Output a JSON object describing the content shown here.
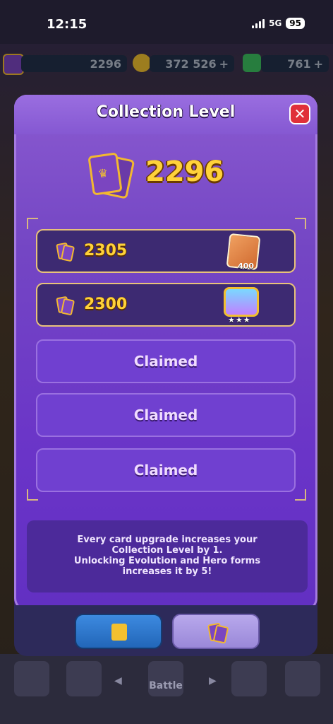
{
  "status_bar": {
    "time": "12:15",
    "network": "5G",
    "battery": "95"
  },
  "resources": {
    "trophies": "2296",
    "gold": "372 526",
    "gems": "761"
  },
  "modal": {
    "title": "Collection Level",
    "current_level": "2296",
    "rewards": [
      {
        "level": "2305",
        "reward": "book",
        "reward_count": "400",
        "state": "locked"
      },
      {
        "level": "2300",
        "reward": "chest",
        "reward_stars": "★★★",
        "state": "locked"
      },
      {
        "label": "Claimed",
        "state": "claimed"
      },
      {
        "label": "Claimed",
        "state": "claimed"
      },
      {
        "label": "Claimed",
        "state": "claimed"
      }
    ],
    "info": [
      "Every card upgrade increases your",
      "Collection Level by 1.",
      "Unlocking Evolution and Hero forms",
      "increases it by 5!"
    ]
  },
  "nav": {
    "battle_label": "Battle"
  },
  "colors": {
    "accent_gold": "#ffd23a",
    "modal_purple": "#6a34c8",
    "close_red": "#e0303a"
  }
}
